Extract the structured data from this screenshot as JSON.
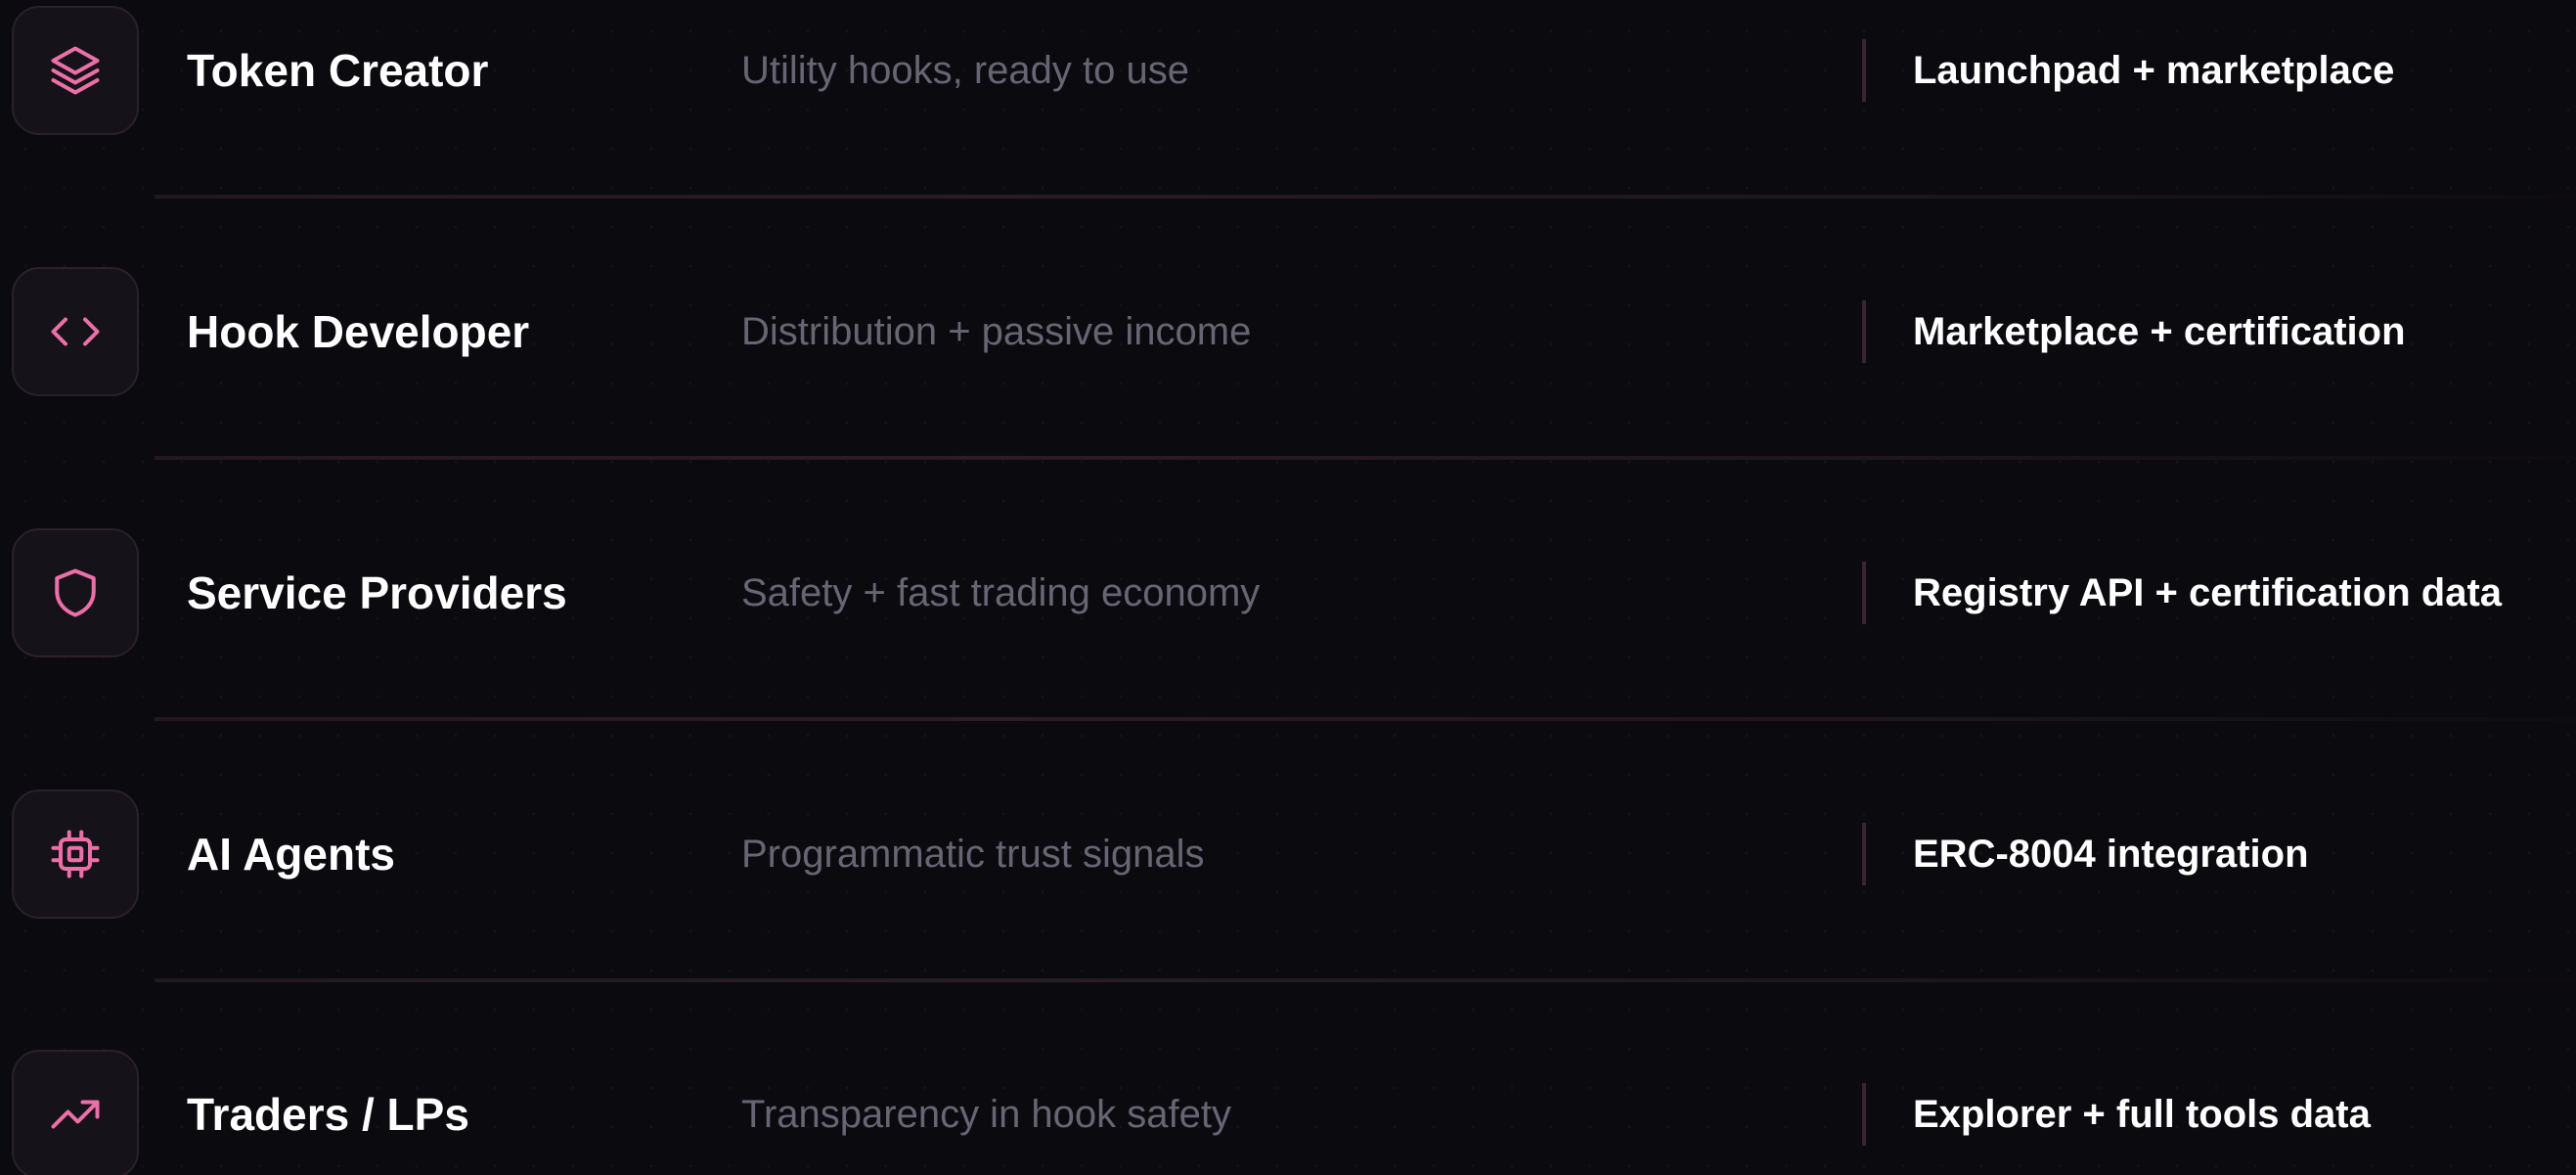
{
  "rows": [
    {
      "icon": "layers-icon",
      "name": "Token Creator",
      "benefit": "Utility hooks, ready to use",
      "product": "Launchpad + marketplace"
    },
    {
      "icon": "code-icon",
      "name": "Hook Developer",
      "benefit": "Distribution + passive income",
      "product": "Marketplace + certification"
    },
    {
      "icon": "shield-icon",
      "name": "Service Providers",
      "benefit": "Safety + fast trading economy",
      "product": "Registry API + certification data"
    },
    {
      "icon": "cpu-chip-icon",
      "name": "AI Agents",
      "benefit": "Programmatic trust signals",
      "product": "ERC-8004 integration"
    },
    {
      "icon": "trending-up-icon",
      "name": "Traders / LPs",
      "benefit": "Transparency in hook safety",
      "product": "Explorer + full tools data"
    }
  ],
  "colors": {
    "background": "#0b0a0f",
    "accent": "#ec6fa8",
    "text_primary": "#ffffff",
    "text_secondary": "#676573"
  }
}
